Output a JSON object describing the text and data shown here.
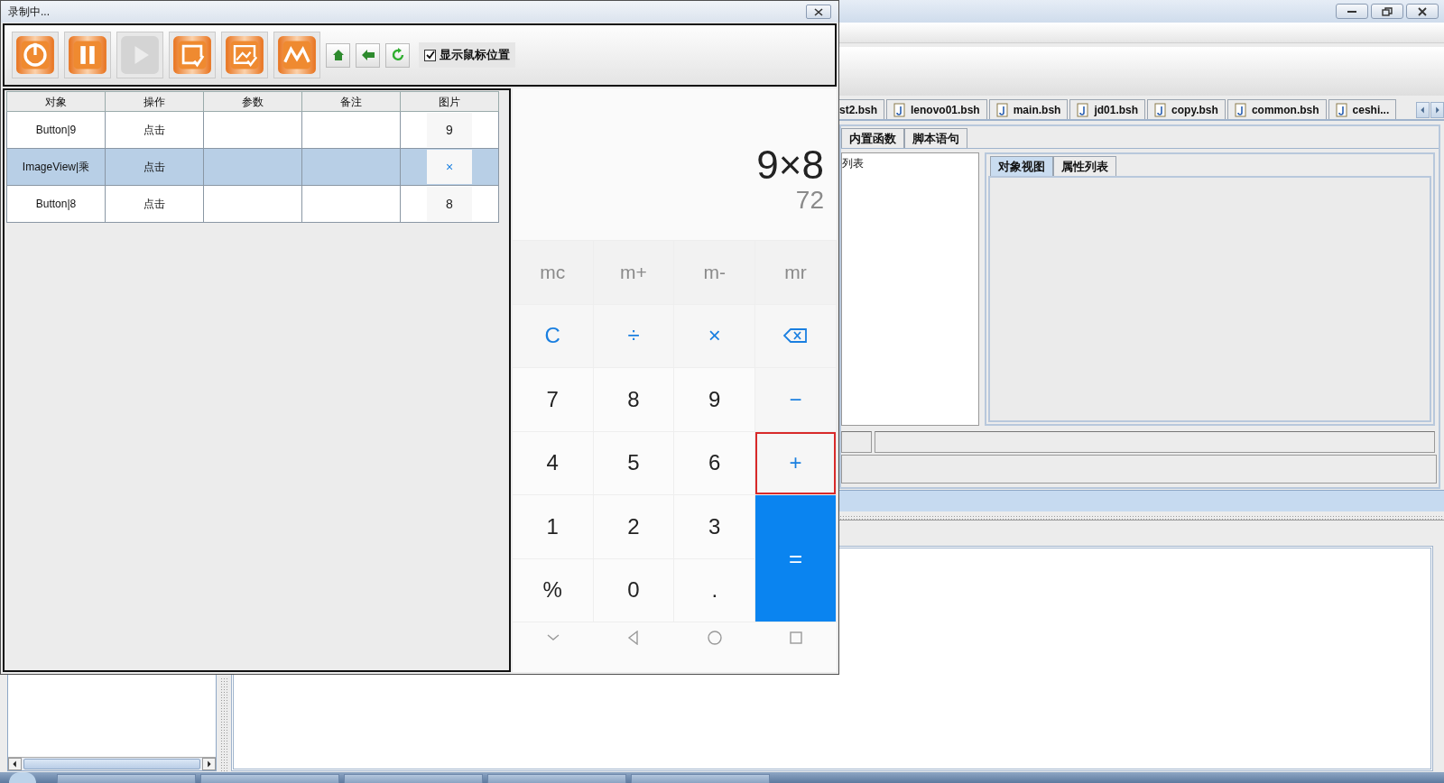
{
  "recorder": {
    "title": "录制中...",
    "tool_buttons": [
      {
        "kind": "power",
        "disabled": false
      },
      {
        "kind": "pause",
        "disabled": false
      },
      {
        "kind": "play",
        "disabled": true
      },
      {
        "kind": "frame-check",
        "disabled": false
      },
      {
        "kind": "image-check",
        "disabled": false
      },
      {
        "kind": "wave",
        "disabled": false
      }
    ],
    "nav_buttons": [
      {
        "kind": "home"
      },
      {
        "kind": "back"
      },
      {
        "kind": "refresh"
      }
    ],
    "show_mouse": {
      "label": "显示鼠标位置",
      "checked": true
    },
    "table": {
      "columns": [
        "对象",
        "操作",
        "参数",
        "备注",
        "图片"
      ],
      "rows": [
        {
          "object": "Button|9",
          "action": "点击",
          "image": "9",
          "color": "#222222",
          "selected": false
        },
        {
          "object": "ImageView|乘",
          "action": "点击",
          "image": "×",
          "color": "#1a7fe0",
          "selected": true
        },
        {
          "object": "Button|8",
          "action": "点击",
          "image": "8",
          "color": "#222222",
          "selected": false
        }
      ]
    }
  },
  "phone": {
    "expression": "9×8",
    "result": "72",
    "keys": [
      {
        "label": "mc",
        "kind": "memory",
        "highlighted": false
      },
      {
        "label": "m+",
        "kind": "memory",
        "highlighted": false
      },
      {
        "label": "m-",
        "kind": "memory",
        "highlighted": false
      },
      {
        "label": "mr",
        "kind": "memory",
        "highlighted": false
      },
      {
        "label": "C",
        "kind": "operator",
        "highlighted": false
      },
      {
        "label": "÷",
        "kind": "operator",
        "highlighted": false
      },
      {
        "label": "×",
        "kind": "operator",
        "highlighted": false
      },
      {
        "kind": "backspace",
        "highlighted": false
      },
      {
        "label": "7",
        "kind": "digit",
        "highlighted": false
      },
      {
        "label": "8",
        "kind": "digit",
        "highlighted": false
      },
      {
        "label": "9",
        "kind": "digit",
        "highlighted": false
      },
      {
        "label": "−",
        "kind": "operator",
        "highlighted": false
      },
      {
        "label": "4",
        "kind": "digit",
        "highlighted": false
      },
      {
        "label": "5",
        "kind": "digit",
        "highlighted": false
      },
      {
        "label": "6",
        "kind": "digit",
        "highlighted": false
      },
      {
        "label": "+",
        "kind": "operator",
        "highlighted": true
      },
      {
        "label": "1",
        "kind": "digit",
        "highlighted": false
      },
      {
        "label": "2",
        "kind": "digit",
        "highlighted": false
      },
      {
        "label": "3",
        "kind": "digit",
        "highlighted": false
      },
      {
        "label": "=",
        "kind": "equals",
        "highlighted": false
      },
      {
        "label": "%",
        "kind": "digit",
        "highlighted": false
      },
      {
        "label": "0",
        "kind": "digit",
        "highlighted": false
      },
      {
        "label": ".",
        "kind": "digit",
        "highlighted": false
      }
    ],
    "nav": [
      {
        "kind": "chevron"
      },
      {
        "kind": "back"
      },
      {
        "kind": "home"
      },
      {
        "kind": "recents"
      }
    ]
  },
  "ide": {
    "file_tabs": [
      {
        "label": "st2.bsh",
        "icon": false
      },
      {
        "label": "lenovo01.bsh",
        "icon": true
      },
      {
        "label": "main.bsh",
        "icon": true
      },
      {
        "label": "jd01.bsh",
        "icon": true
      },
      {
        "label": "copy.bsh",
        "icon": true
      },
      {
        "label": "common.bsh",
        "icon": true
      },
      {
        "label": "ceshi...",
        "icon": true
      }
    ],
    "func_tabs": [
      "内置函数",
      "脚本语句"
    ],
    "list_items": [
      "列表"
    ],
    "view_tabs": [
      {
        "label": "对象视图",
        "selected": true
      },
      {
        "label": "属性列表",
        "selected": false
      }
    ]
  }
}
